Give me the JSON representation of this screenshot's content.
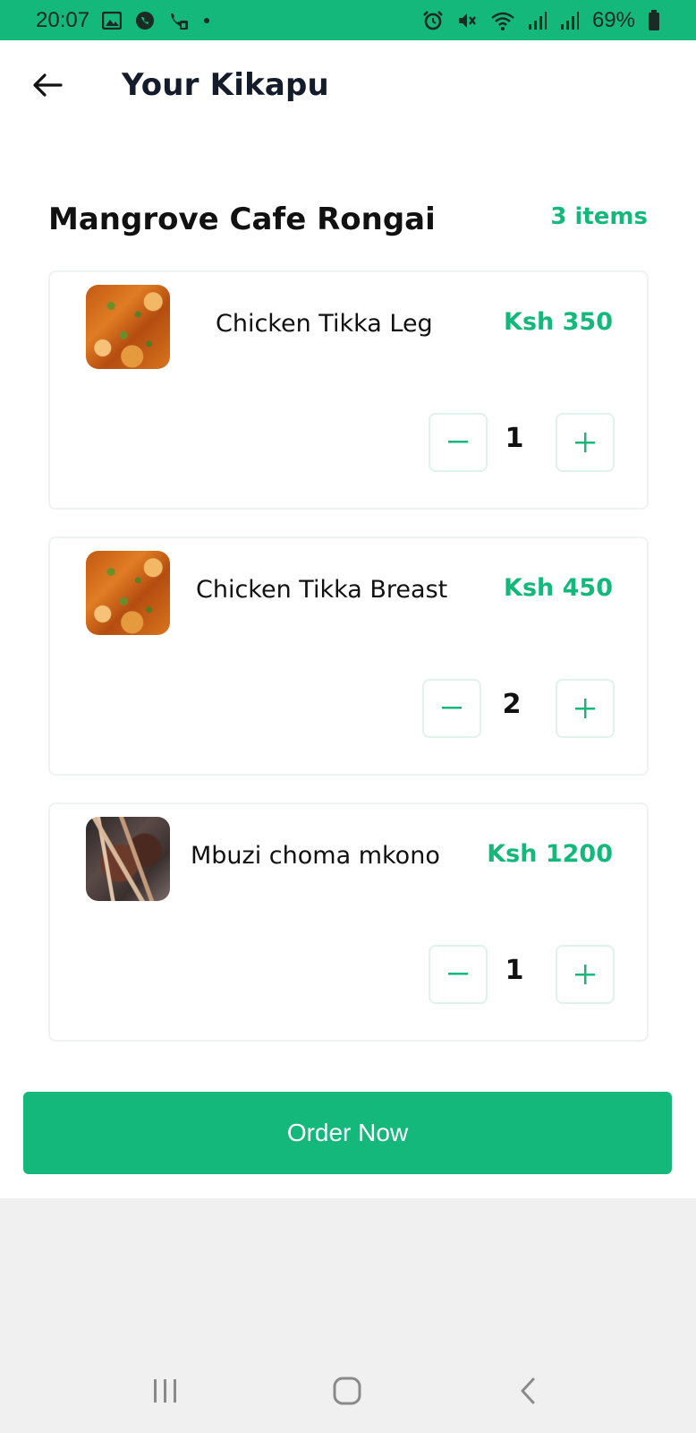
{
  "status_bar": {
    "time": "20:07",
    "battery": "69%",
    "icons": [
      "gallery-icon",
      "whatsapp-icon",
      "wifi-call-icon",
      "dot-icon",
      "alarm-icon",
      "mute-icon",
      "wifi-icon",
      "signal-icon",
      "signal-icon",
      "battery-icon"
    ],
    "background_color": "#14b87a"
  },
  "header": {
    "title": "Your Kikapu",
    "back_icon": "arrow-left-icon"
  },
  "restaurant": {
    "name": "Mangrove Cafe Rongai",
    "items_count": "3 items"
  },
  "cart": {
    "items": [
      {
        "name": "Chicken Tikka Leg",
        "price": "Ksh 350",
        "quantity": "1",
        "image": "chicken-tikka-image"
      },
      {
        "name": "Chicken Tikka Breast",
        "price": "Ksh 450",
        "quantity": "2",
        "image": "chicken-tikka-image"
      },
      {
        "name": "Mbuzi choma mkono",
        "price": "Ksh 1200",
        "quantity": "1",
        "image": "mbuzi-choma-image"
      }
    ]
  },
  "order_button": {
    "label": "Order Now"
  },
  "nav_bar": {
    "icons": [
      "recent-apps-icon",
      "home-icon",
      "back-icon"
    ]
  },
  "colors": {
    "accent": "#14b87a",
    "title": "#141c2b",
    "card_border": "#eef2f0"
  }
}
